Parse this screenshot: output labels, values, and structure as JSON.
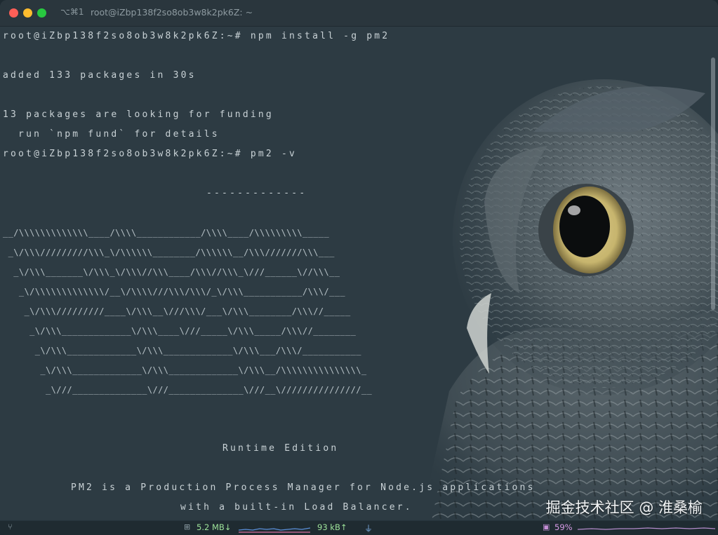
{
  "window": {
    "shortcut": "⌥⌘1",
    "title": "root@iZbp138f2so8ob3w8k2pk6Z: ~"
  },
  "terminal": {
    "lines": [
      "root@iZbp138f2so8ob3w8k2pk6Z:~# npm install -g pm2",
      "",
      "added 133 packages in 30s",
      "",
      "13 packages are looking for funding",
      "  run `npm fund` for details",
      "root@iZbp138f2so8ob3w8k2pk6Z:~# pm2 -v"
    ],
    "banner_rule": "-------------",
    "banner_art": [
      "__/\\\\\\\\\\\\\\\\\\\\\\\\\\____/\\\\\\\\____________/\\\\\\\\____/\\\\\\\\\\\\\\\\\\_____",
      " _\\/\\\\\\/////////\\\\\\_\\/\\\\\\\\\\\\________/\\\\\\\\\\\\__/\\\\\\///////\\\\\\___",
      "  _\\/\\\\\\_______\\/\\\\\\_\\/\\\\\\//\\\\\\____/\\\\\\//\\\\\\_\\///______\\//\\\\\\__",
      "   _\\/\\\\\\\\\\\\\\\\\\\\\\\\\\/__\\/\\\\\\\\///\\\\\\/\\\\\\/_\\/\\\\\\___________/\\\\\\/___",
      "    _\\/\\\\\\/////////____\\/\\\\\\__\\///\\\\\\/___\\/\\\\\\________/\\\\\\//_____",
      "     _\\/\\\\\\_____________\\/\\\\\\____\\///_____\\/\\\\\\_____/\\\\\\//________",
      "      _\\/\\\\\\_____________\\/\\\\\\_____________\\/\\\\\\___/\\\\\\/___________",
      "       _\\/\\\\\\_____________\\/\\\\\\_____________\\/\\\\\\__/\\\\\\\\\\\\\\\\\\\\\\\\\\\\\\_",
      "        _\\///______________\\///______________\\///__\\///////////////__"
    ],
    "edition": "Runtime Edition",
    "description_1": "PM2 is a Production Process Manager for Node.js applications",
    "description_2": "with a built-in Load Balancer."
  },
  "watermark": "掘金技术社区 @ 淮桑榆",
  "statusbar": {
    "branch_icon": "branch-icon",
    "net_icon": "network-icon",
    "net_down": "5.2 MB↓",
    "net_up": "93 kB↑",
    "plug_icon": "plug-icon",
    "cpu_icon": "cpu-icon",
    "cpu_value": "59%",
    "colors": {
      "net": "#9ee39a",
      "cpu": "#d79be6",
      "plug": "#7fb0e6"
    }
  }
}
